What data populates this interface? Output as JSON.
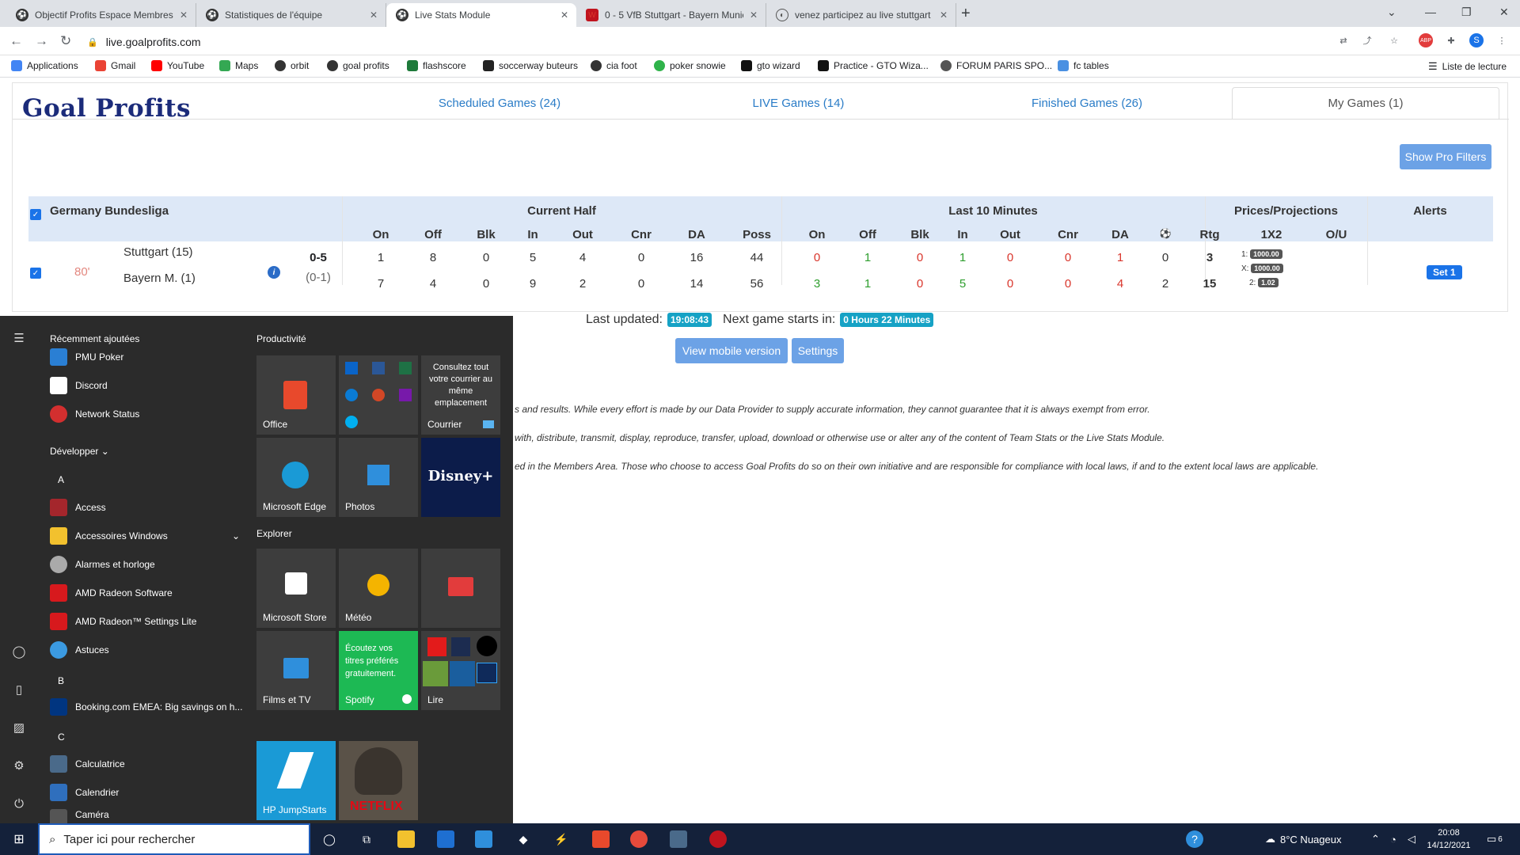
{
  "browser": {
    "tabs": [
      {
        "title": "Objectif Profits Espace Membres",
        "active": false
      },
      {
        "title": "Statistiques de l'équipe",
        "active": false
      },
      {
        "title": "Live Stats Module",
        "active": true
      },
      {
        "title": "0 - 5 VfB Stuttgart - Bayern Munic",
        "active": false
      },
      {
        "title": "venez participez au live stuttgart",
        "active": false
      }
    ],
    "url": "live.goalprofits.com",
    "profile_initial": "S",
    "bookmarks": [
      {
        "label": "Applications",
        "color": "#4285f4"
      },
      {
        "label": "Gmail",
        "color": "#ea4335"
      },
      {
        "label": "YouTube",
        "color": "#ff0000"
      },
      {
        "label": "Maps",
        "color": "#34a853"
      },
      {
        "label": "orbit",
        "color": "#333333"
      },
      {
        "label": "goal profits",
        "color": "#333333"
      },
      {
        "label": "flashscore",
        "color": "#1e7a3a"
      },
      {
        "label": "soccerway buteurs",
        "color": "#222222"
      },
      {
        "label": "cia foot",
        "color": "#333333"
      },
      {
        "label": "poker snowie",
        "color": "#2fb34a"
      },
      {
        "label": "gto wizard",
        "color": "#111111"
      },
      {
        "label": "Practice - GTO Wiza...",
        "color": "#111111"
      },
      {
        "label": "FORUM PARIS SPO...",
        "color": "#555555"
      },
      {
        "label": "fc tables",
        "color": "#4a90e2"
      }
    ],
    "reading_list": "Liste de lecture"
  },
  "site": {
    "logo": "Goal Profits",
    "nav": [
      {
        "label": "Scheduled Games (24)"
      },
      {
        "label": "LIVE Games (14)"
      },
      {
        "label": "Finished Games (26)"
      },
      {
        "label": "My Games (1)"
      }
    ],
    "pro_filters": "Show Pro Filters",
    "league": "Germany Bundesliga",
    "groups": {
      "current_half": "Current Half",
      "last10": "Last 10 Minutes",
      "prices": "Prices/Projections",
      "alerts": "Alerts"
    },
    "cols_half": [
      "On",
      "Off",
      "Blk",
      "In",
      "Out",
      "Cnr",
      "DA",
      "Poss"
    ],
    "cols_last10": [
      "On",
      "Off",
      "Blk",
      "In",
      "Out",
      "Cnr",
      "DA",
      "Rtg"
    ],
    "cols_prices": [
      "1X2",
      "O/U"
    ],
    "match": {
      "minute": "80'",
      "home": "Stuttgart (15)",
      "away": "Bayern M. (1)",
      "score": "0-5",
      "ht_score": "(0-1)",
      "home_half": [
        "1",
        "8",
        "0",
        "5",
        "4",
        "0",
        "16",
        "44"
      ],
      "away_half": [
        "7",
        "4",
        "0",
        "9",
        "2",
        "0",
        "14",
        "56"
      ],
      "home_last10": [
        "0",
        "1",
        "0",
        "1",
        "0",
        "0",
        "1",
        "0",
        "3"
      ],
      "away_last10": [
        "3",
        "1",
        "0",
        "5",
        "0",
        "0",
        "4",
        "2",
        "15"
      ],
      "prices": [
        {
          "k": "1:",
          "v": "1000.00"
        },
        {
          "k": "X:",
          "v": "1000.00"
        },
        {
          "k": "2:",
          "v": "1.02"
        }
      ],
      "alert": "Set 1"
    },
    "last_updated_label": "Last updated:",
    "last_updated": "19:08:43",
    "next_game_label": "Next game starts in:",
    "next_game": "0 Hours 22 Minutes",
    "mobile_btn": "View mobile version",
    "settings_btn": "Settings",
    "disclaimer": [
      "s and results. While every effort is made by our Data Provider to supply accurate information, they cannot guarantee that it is always exempt from error.",
      "with, distribute, transmit, display, reproduce, transfer, upload, download or otherwise use or alter any of the content of Team Stats or the Live Stats Module.",
      "ed in the Members Area. Those who choose to access Goal Profits do so on their own initiative and are responsible for compliance with local laws, if and to the extent local laws are applicable."
    ]
  },
  "start_menu": {
    "recent_header": "Récemment ajoutées",
    "recent": [
      {
        "label": "PMU Poker",
        "color": "#2a7fd4"
      },
      {
        "label": "Discord",
        "color": "#ffffff"
      },
      {
        "label": "Network Status",
        "color": "#d32f2f"
      }
    ],
    "developer": "Développer",
    "apps": [
      {
        "letter": "A"
      },
      {
        "label": "Access",
        "color": "#a4262c"
      },
      {
        "label": "Accessoires Windows",
        "color": "#f2c12e"
      },
      {
        "label": "Alarmes et horloge",
        "color": "#aaaaaa"
      },
      {
        "label": "AMD Radeon Software",
        "color": "#d7191d"
      },
      {
        "label": "AMD Radeon™ Settings Lite",
        "color": "#d7191d"
      },
      {
        "label": "Astuces",
        "color": "#3b9ae1"
      },
      {
        "letter": "B"
      },
      {
        "label": "Booking.com EMEA: Big savings on h...",
        "color": "#003580"
      },
      {
        "letter": "C"
      },
      {
        "label": "Calculatrice",
        "color": "#4a6a8a"
      },
      {
        "label": "Calendrier",
        "color": "#2f6fbd"
      },
      {
        "label": "Caméra",
        "color": "#555555"
      }
    ],
    "groups": [
      "Productivité",
      "Explorer"
    ],
    "tiles": {
      "office": "Office",
      "mail_text": "Consultez tout votre courrier au même emplacement",
      "courrier": "Courrier",
      "edge": "Microsoft Edge",
      "photos": "Photos",
      "disney": "Disney+",
      "store": "Microsoft Store",
      "meteo": "Météo",
      "films": "Films et TV",
      "spotify_text": "Écoutez vos titres préférés gratuitement.",
      "spotify": "Spotify",
      "lire": "Lire",
      "hp": "HP JumpStarts",
      "netflix": "NETFLIX"
    }
  },
  "taskbar": {
    "search_placeholder": "Taper ici pour rechercher",
    "weather": "8°C  Nuageux",
    "time": "20:08",
    "date": "14/12/2021",
    "notif": "6"
  }
}
